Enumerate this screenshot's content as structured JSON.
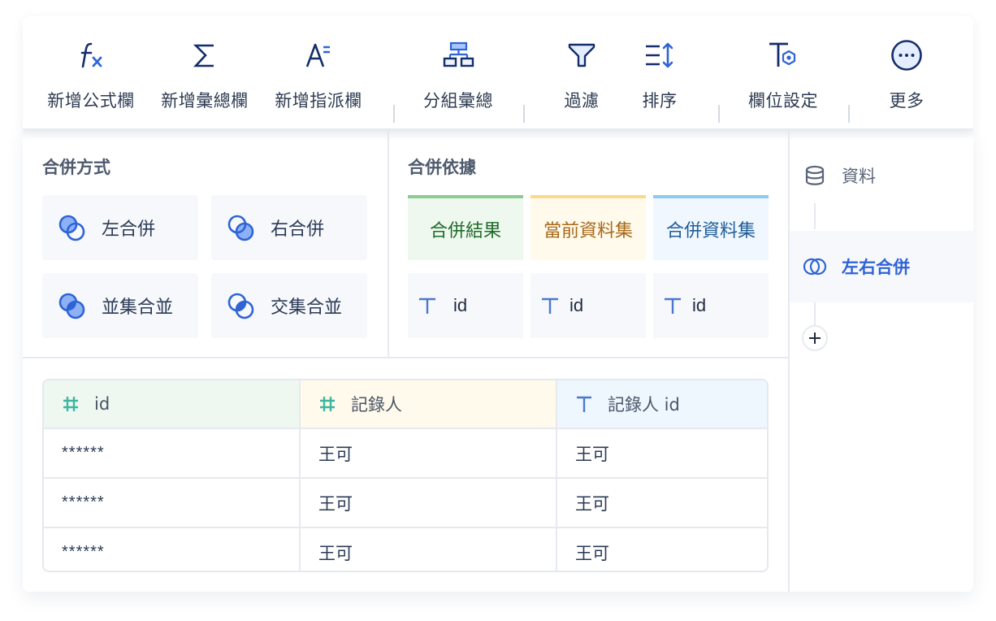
{
  "toolbar": {
    "items": [
      {
        "label": "新增公式欄",
        "icon": "function-fx-icon"
      },
      {
        "label": "新增彙總欄",
        "icon": "sigma-sum-icon"
      },
      {
        "label": "新增指派欄",
        "icon": "assign-column-icon"
      },
      {
        "label": "分組彙總",
        "icon": "group-hierarchy-icon"
      },
      {
        "label": "過濾",
        "icon": "filter-funnel-icon"
      },
      {
        "label": "排序",
        "icon": "sort-icon"
      },
      {
        "label": "欄位設定",
        "icon": "field-settings-icon"
      },
      {
        "label": "更多",
        "icon": "more-ellipsis-icon"
      }
    ]
  },
  "join_method": {
    "title": "合併方式",
    "options": [
      {
        "label": "左合併",
        "icon": "left-join-icon"
      },
      {
        "label": "右合併",
        "icon": "right-join-icon"
      },
      {
        "label": "並集合並",
        "icon": "union-join-icon"
      },
      {
        "label": "交集合並",
        "icon": "intersect-join-icon"
      }
    ]
  },
  "join_basis": {
    "title": "合併依據",
    "columns": [
      {
        "header": "合併結果",
        "key": "id",
        "color": "#8fcc92"
      },
      {
        "header": "當前資料集",
        "key": "id",
        "color": "#fcd98b"
      },
      {
        "header": "合併資料集",
        "key": "id",
        "color": "#8ccaf5"
      }
    ]
  },
  "preview_table": {
    "columns": [
      {
        "label": "id",
        "type": "number"
      },
      {
        "label": "記錄人",
        "type": "number"
      },
      {
        "label": "記錄人 id",
        "type": "text"
      }
    ],
    "rows": [
      [
        "******",
        "王可",
        "王可"
      ],
      [
        "******",
        "王可",
        "王可"
      ],
      [
        "******",
        "王可",
        "王可"
      ]
    ]
  },
  "flow": {
    "steps": [
      {
        "label": "資料",
        "icon": "database-icon",
        "active": false
      },
      {
        "label": "左右合併",
        "icon": "join-circles-icon",
        "active": true
      }
    ],
    "add_label": "+"
  },
  "colors": {
    "accent": "#2f63d6",
    "icon_dark": "#152d6b",
    "text": "#2b3a55"
  }
}
